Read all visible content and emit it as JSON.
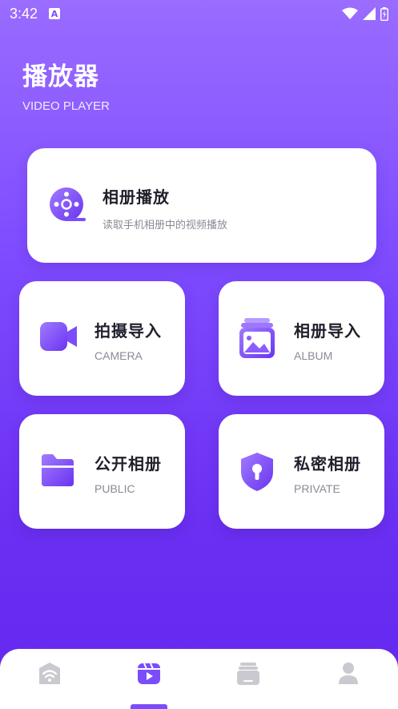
{
  "status_bar": {
    "time": "3:42",
    "a_badge": "A"
  },
  "header": {
    "title": "播放器",
    "subtitle": "VIDEO PLAYER"
  },
  "cards": {
    "main": {
      "title": "相册播放",
      "subtitle": "读取手机相册中的视频播放",
      "icon": "film-reel-icon"
    },
    "camera": {
      "title": "拍摄导入",
      "subtitle": "CAMERA",
      "icon": "video-camera-icon"
    },
    "album": {
      "title": "相册导入",
      "subtitle": "ALBUM",
      "icon": "photo-album-icon"
    },
    "public": {
      "title": "公开相册",
      "subtitle": "PUBLIC",
      "icon": "folder-icon"
    },
    "private": {
      "title": "私密相册",
      "subtitle": "PRIVATE",
      "icon": "shield-lock-icon"
    }
  },
  "bottom_nav": {
    "active_index": 1,
    "items": [
      {
        "icon": "wifi-home-icon",
        "active": false
      },
      {
        "icon": "video-player-icon",
        "active": true
      },
      {
        "icon": "album-stack-icon",
        "active": false
      },
      {
        "icon": "profile-icon",
        "active": false
      }
    ]
  },
  "colors": {
    "accent": "#7b4cfb",
    "inactive": "#c9c9cf",
    "background_top": "#9a6cff",
    "background_bottom": "#6328ef"
  }
}
